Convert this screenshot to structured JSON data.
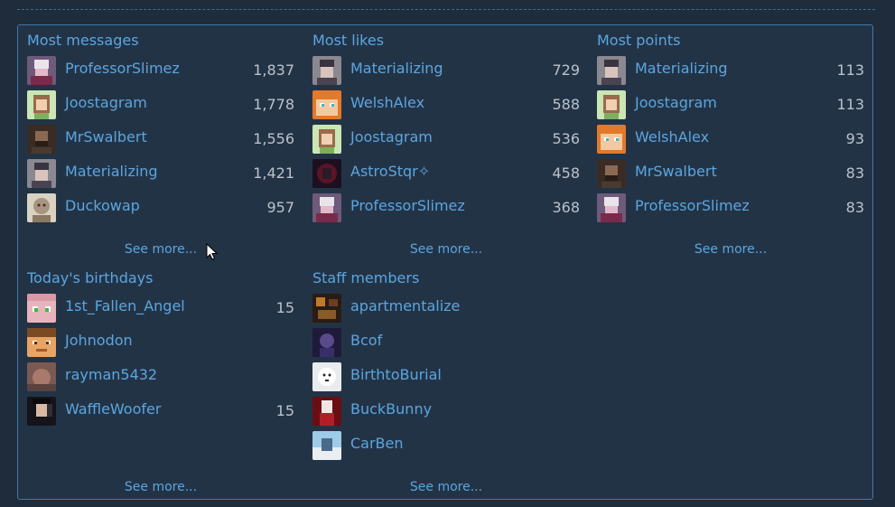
{
  "sections": {
    "most_messages": {
      "title": "Most messages",
      "see_more": "See more...",
      "rows": [
        {
          "name": "ProfessorSlimez",
          "value": "1,837"
        },
        {
          "name": "Joostagram",
          "value": "1,778"
        },
        {
          "name": "MrSwalbert",
          "value": "1,556"
        },
        {
          "name": "Materializing",
          "value": "1,421"
        },
        {
          "name": "Duckowap",
          "value": "957"
        }
      ]
    },
    "most_likes": {
      "title": "Most likes",
      "see_more": "See more...",
      "rows": [
        {
          "name": "Materializing",
          "value": "729"
        },
        {
          "name": "WelshAlex",
          "value": "588"
        },
        {
          "name": "Joostagram",
          "value": "536"
        },
        {
          "name": "AstroStqr✧",
          "value": "458"
        },
        {
          "name": "ProfessorSlimez",
          "value": "368"
        }
      ]
    },
    "most_points": {
      "title": "Most points",
      "see_more": "See more...",
      "rows": [
        {
          "name": "Materializing",
          "value": "113"
        },
        {
          "name": "Joostagram",
          "value": "113"
        },
        {
          "name": "WelshAlex",
          "value": "93"
        },
        {
          "name": "MrSwalbert",
          "value": "83"
        },
        {
          "name": "ProfessorSlimez",
          "value": "83"
        }
      ]
    },
    "birthdays": {
      "title": "Today's birthdays",
      "see_more": "See more...",
      "rows": [
        {
          "name": "1st_Fallen_Angel",
          "value": "15"
        },
        {
          "name": "Johnodon",
          "value": ""
        },
        {
          "name": "rayman5432",
          "value": ""
        },
        {
          "name": "WaffleWoofer",
          "value": "15"
        }
      ]
    },
    "staff": {
      "title": "Staff members",
      "see_more": "See more...",
      "rows": [
        {
          "name": "apartmentalize",
          "value": ""
        },
        {
          "name": "Bcof",
          "value": ""
        },
        {
          "name": "BirthtoBurial",
          "value": ""
        },
        {
          "name": "BuckBunny",
          "value": ""
        },
        {
          "name": "CarBen",
          "value": ""
        }
      ]
    }
  }
}
